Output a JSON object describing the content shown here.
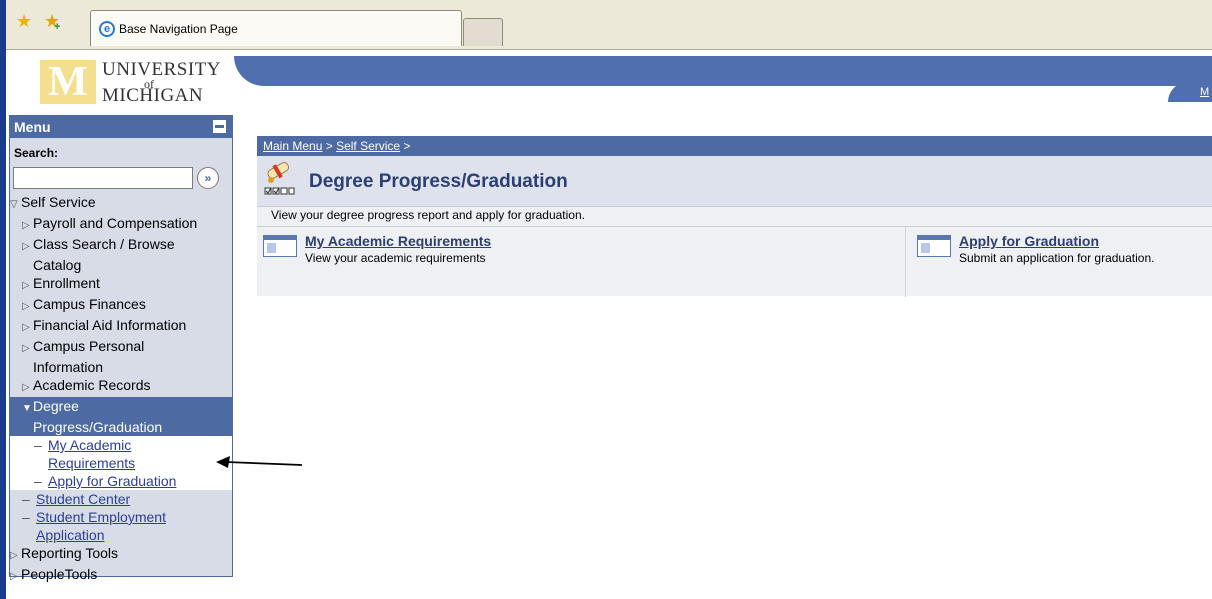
{
  "browser": {
    "tab_title": "Base Navigation Page"
  },
  "header": {
    "logo_line1": "UNIVERSITY",
    "logo_of": "of",
    "logo_line2": "MICHIGAN",
    "logo_block_letter": "M",
    "right_link_fragment": "M"
  },
  "menu": {
    "title": "Menu",
    "search_label": "Search:",
    "search_value": "",
    "search_go_glyph": "»",
    "items": [
      {
        "label": "Self Service",
        "level": 0,
        "state": "expanded"
      },
      {
        "label": "Payroll and Compensation",
        "level": 1,
        "state": "collapsed"
      },
      {
        "label": "Class Search / Browse",
        "level": 1,
        "state": "collapsed"
      },
      {
        "label": "Catalog",
        "level": 1,
        "state": "continuation"
      },
      {
        "label": "Enrollment",
        "level": 1,
        "state": "collapsed"
      },
      {
        "label": "Campus Finances",
        "level": 1,
        "state": "collapsed"
      },
      {
        "label": "Financial Aid Information",
        "level": 1,
        "state": "collapsed"
      },
      {
        "label": "Campus Personal",
        "level": 1,
        "state": "collapsed"
      },
      {
        "label": "Information",
        "level": 1,
        "state": "continuation"
      },
      {
        "label": "Academic Records",
        "level": 1,
        "state": "collapsed"
      },
      {
        "label": "Degree",
        "level": 1,
        "state": "selected"
      },
      {
        "label": "Progress/Graduation",
        "level": 1,
        "state": "selected-continuation"
      },
      {
        "label": "My Academic",
        "level": 2,
        "state": "link"
      },
      {
        "label": "Requirements",
        "level": 2,
        "state": "link-continuation"
      },
      {
        "label": "Apply for Graduation",
        "level": 2,
        "state": "link"
      },
      {
        "label": "Student Center",
        "level": 1,
        "state": "link"
      },
      {
        "label": "Student Employment",
        "level": 1,
        "state": "link"
      },
      {
        "label": "Application",
        "level": 1,
        "state": "link-continuation"
      },
      {
        "label": "Reporting Tools",
        "level": 0,
        "state": "collapsed"
      },
      {
        "label": "PeopleTools",
        "level": 0,
        "state": "collapsed"
      }
    ]
  },
  "content": {
    "breadcrumb": {
      "main_menu": "Main Menu",
      "sep1": " > ",
      "self_service": "Self Service",
      "sep2": " >"
    },
    "title": "Degree Progress/Graduation",
    "description": "View your degree progress report and apply for graduation.",
    "cards": [
      {
        "link": "My Academic Requirements",
        "desc": "View your academic requirements"
      },
      {
        "link": "Apply for Graduation",
        "desc": "Submit an application for graduation."
      }
    ]
  },
  "colors": {
    "accent_blue": "#4d6aa3",
    "menu_bg": "#d8dce7",
    "link": "#2b3f96",
    "logo_maize": "#f3df8e"
  }
}
